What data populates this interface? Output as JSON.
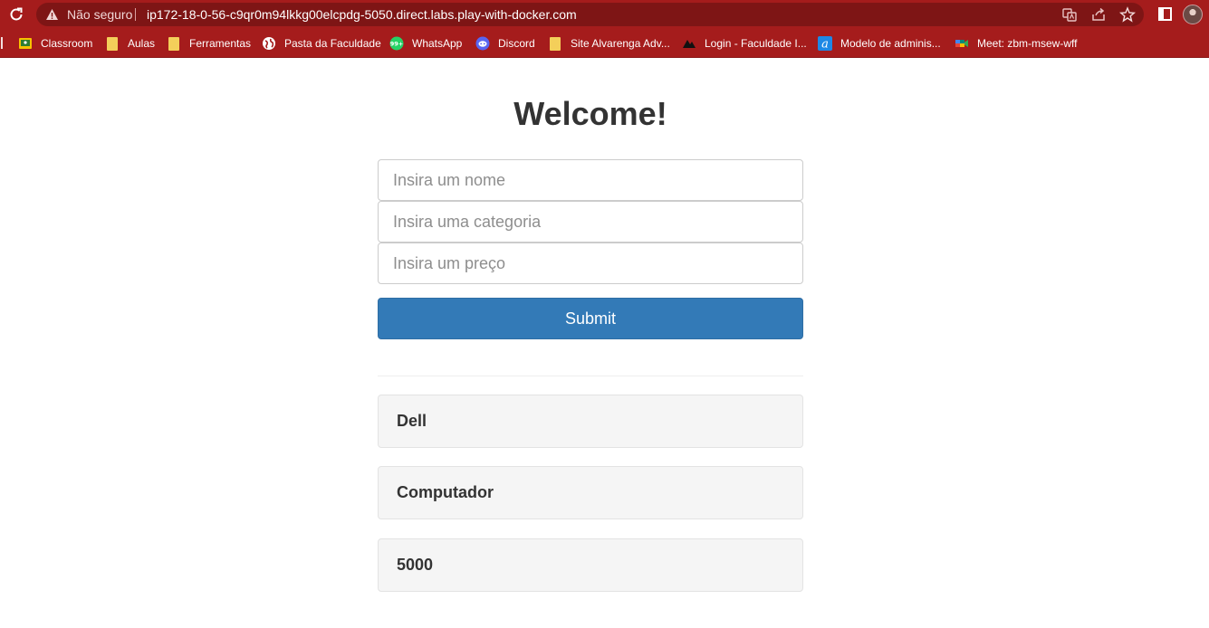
{
  "browser": {
    "security_label": "Não seguro",
    "url": "ip172-18-0-56-c9qr0m94lkkg00elcpdg-5050.direct.labs.play-with-docker.com",
    "bookmarks": [
      {
        "label": "Classroom",
        "icon": "classroom-icon"
      },
      {
        "label": "Aulas",
        "icon": "folder-icon"
      },
      {
        "label": "Ferramentas",
        "icon": "folder-icon"
      },
      {
        "label": "Pasta da Faculdade",
        "icon": "globe-icon"
      },
      {
        "label": "WhatsApp",
        "icon": "whatsapp-icon"
      },
      {
        "label": "Discord",
        "icon": "discord-icon"
      },
      {
        "label": "Site Alvarenga Adv...",
        "icon": "folder-icon"
      },
      {
        "label": "Login - Faculdade I...",
        "icon": "faculdade-logo-icon"
      },
      {
        "label": "Modelo de adminis...",
        "icon": "a-logo-icon"
      },
      {
        "label": "Meet: zbm-msew-wff",
        "icon": "meet-icon"
      }
    ],
    "whatsapp_badge": "99+"
  },
  "page": {
    "title": "Welcome!",
    "form": {
      "name_placeholder": "Insira um nome",
      "category_placeholder": "Insira uma categoria",
      "price_placeholder": "Insira um preço",
      "submit_label": "Submit"
    },
    "results": [
      "Dell",
      "Computador",
      "5000"
    ]
  }
}
